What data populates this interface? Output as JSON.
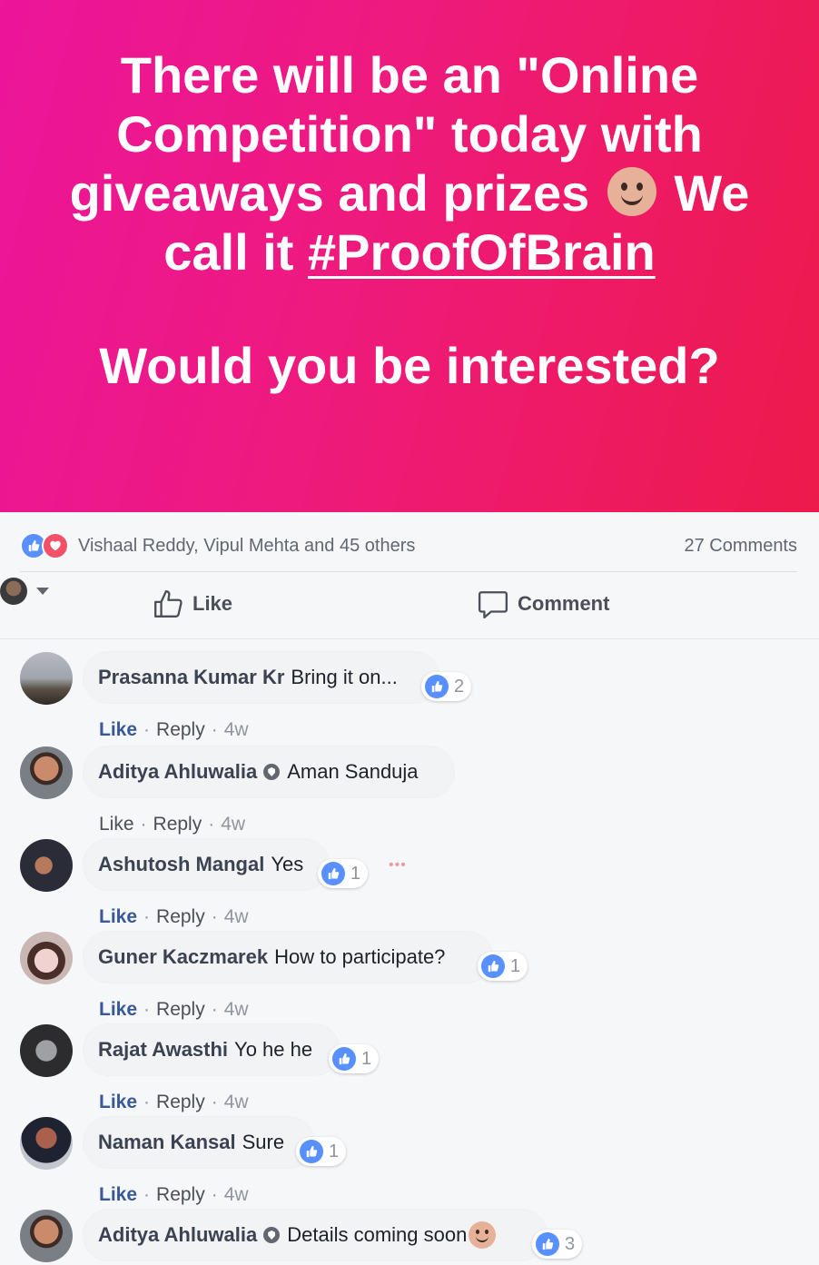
{
  "post": {
    "line1": "There will be an \"Online Competition\" today with giveaways and prizes",
    "line1_after": "We call it",
    "hashtag": "#ProofOfBrain",
    "question": "Would you be interested?",
    "emoji": "slightly-smiling-face",
    "gradient_start": "#ec159b",
    "gradient_end": "#ed1a4b"
  },
  "stats": {
    "reactors": "Vishaal Reddy, Vipul Mehta and 45 others",
    "comments_count": "27 Comments"
  },
  "actions": {
    "like": "Like",
    "comment": "Comment"
  },
  "comments": [
    {
      "author": "Prasanna Kumar Kr",
      "text": "Bring it on...",
      "likes": "2",
      "liked": true,
      "time": "4w",
      "badge": false
    },
    {
      "author": "Aditya Ahluwalia",
      "text": "Aman Sanduja",
      "likes": "",
      "liked": false,
      "time": "4w",
      "badge": true
    },
    {
      "author": "Ashutosh Mangal",
      "text": "Yes",
      "likes": "1",
      "liked": true,
      "time": "4w",
      "badge": false
    },
    {
      "author": "Guner Kaczmarek",
      "text": "How to participate?",
      "likes": "1",
      "liked": true,
      "time": "4w",
      "badge": false
    },
    {
      "author": "Rajat Awasthi",
      "text": "Yo he he",
      "likes": "1",
      "liked": true,
      "time": "4w",
      "badge": false
    },
    {
      "author": "Naman Kansal",
      "text": "Sure",
      "likes": "1",
      "liked": true,
      "time": "4w",
      "badge": false
    },
    {
      "author": "Aditya Ahluwalia",
      "text": "Details coming soon",
      "likes": "3",
      "liked": false,
      "time": "",
      "badge": true
    }
  ],
  "comment_actions": {
    "like": "Like",
    "reply": "Reply",
    "dot": "·"
  }
}
